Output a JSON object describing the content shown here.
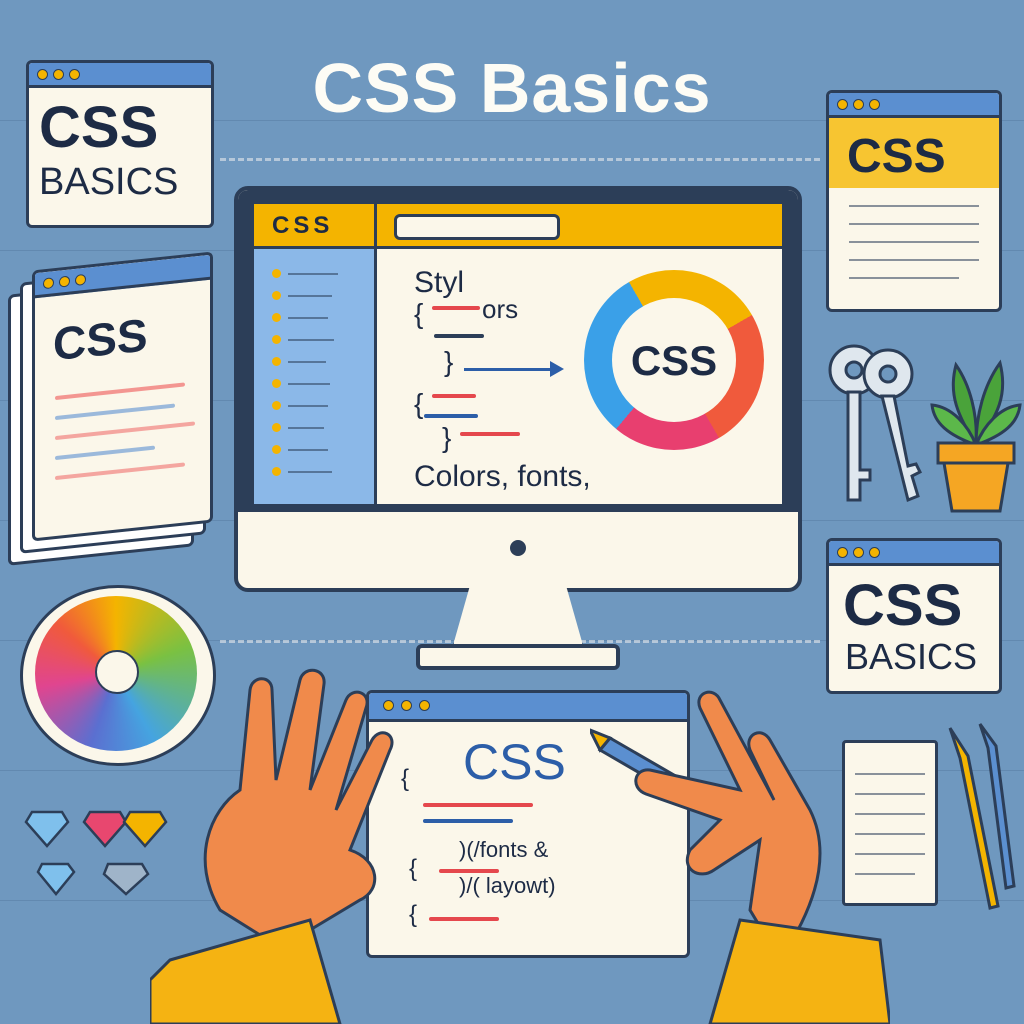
{
  "title": "CSS Basics",
  "top_left_card": {
    "line1": "CSS",
    "line2": "BASICS"
  },
  "top_right_card": {
    "label": "CSS"
  },
  "book": {
    "label": "CSS"
  },
  "monitor": {
    "tab_label": "CSS",
    "code_top": "Styl",
    "code_top2": "ors",
    "brackets": [
      "{",
      "}",
      "{",
      "}"
    ],
    "logo_label": "CSS",
    "caption": "Colors, fonts,"
  },
  "bottom_right_card": {
    "line1": "CSS",
    "line2": "BASICS"
  },
  "bottom_window": {
    "label": "CSS",
    "code_line1": ")(/fonts &",
    "code_line2": ")/( layowt)",
    "brackets": [
      "{",
      "{",
      "{"
    ]
  },
  "colors": {
    "background": "#6f98bf",
    "accent_yellow": "#f4b400",
    "dark_ink": "#1d2b45",
    "hand": "#f08a4b",
    "sleeve": "#f5b312"
  }
}
